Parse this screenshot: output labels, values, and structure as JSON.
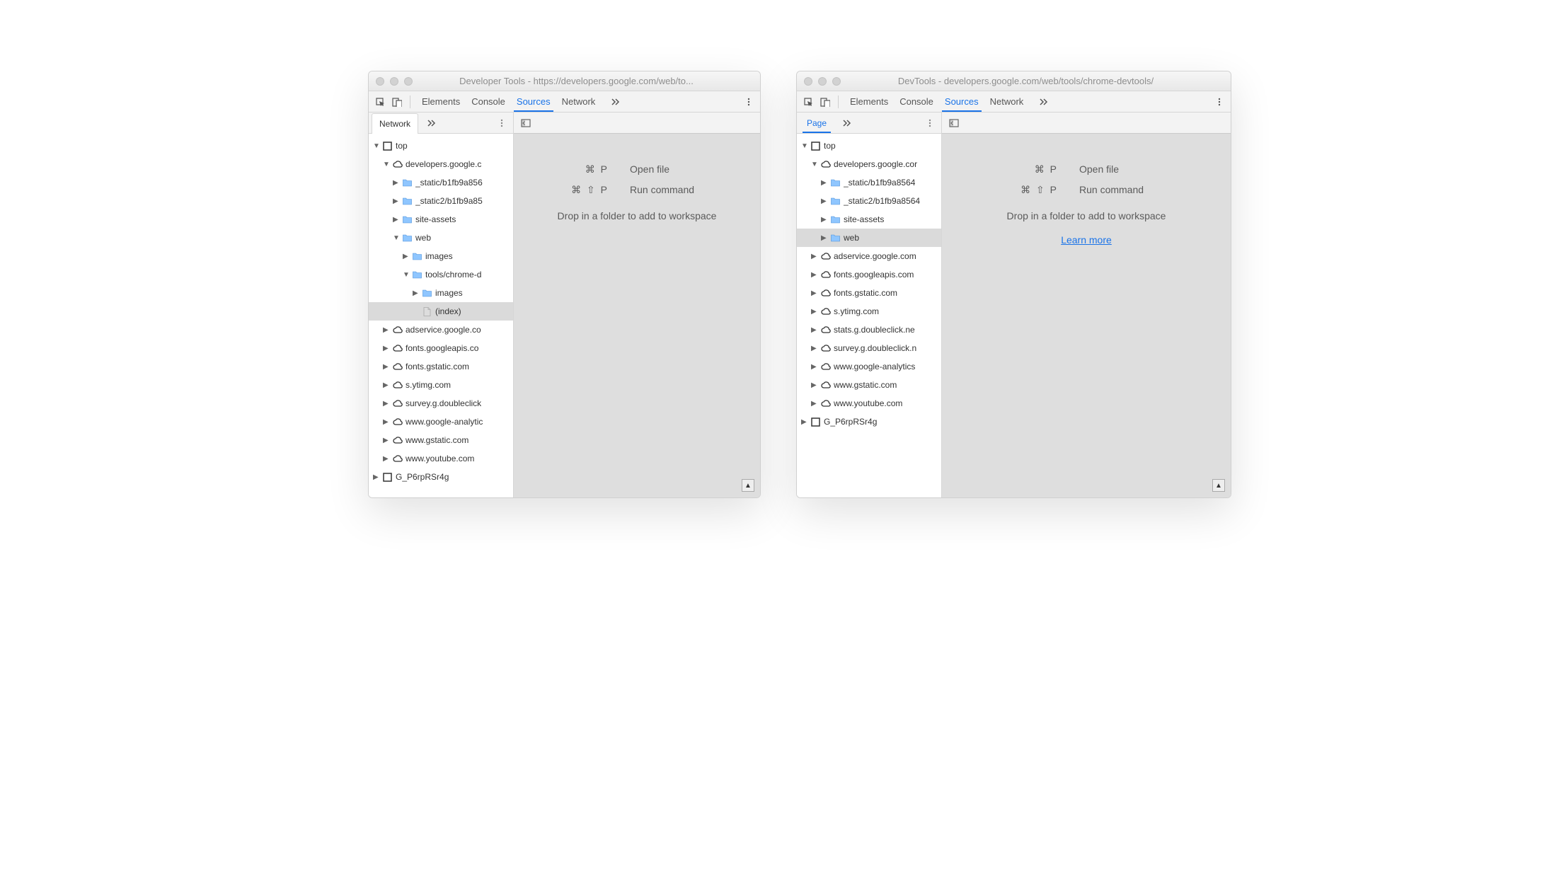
{
  "windows": [
    {
      "id": "left",
      "title": "Developer Tools - https://developers.google.com/web/to...",
      "tabs": [
        "Elements",
        "Console",
        "Sources",
        "Network"
      ],
      "activeTab": "Sources",
      "sidebarTab": "Network",
      "sidebarTabStyle": "classic",
      "tree": [
        {
          "indent": 0,
          "arrow": "down",
          "icon": "frame",
          "label": "top"
        },
        {
          "indent": 1,
          "arrow": "down",
          "icon": "cloud",
          "label": "developers.google.c"
        },
        {
          "indent": 2,
          "arrow": "right",
          "icon": "folder",
          "label": "_static/b1fb9a856"
        },
        {
          "indent": 2,
          "arrow": "right",
          "icon": "folder",
          "label": "_static2/b1fb9a85"
        },
        {
          "indent": 2,
          "arrow": "right",
          "icon": "folder",
          "label": "site-assets"
        },
        {
          "indent": 2,
          "arrow": "down",
          "icon": "folder",
          "label": "web"
        },
        {
          "indent": 3,
          "arrow": "right",
          "icon": "folder",
          "label": "images"
        },
        {
          "indent": 3,
          "arrow": "down",
          "icon": "folder",
          "label": "tools/chrome-d"
        },
        {
          "indent": 4,
          "arrow": "right",
          "icon": "folder",
          "label": "images"
        },
        {
          "indent": 4,
          "arrow": "blank",
          "icon": "file",
          "label": "(index)",
          "selected": true
        },
        {
          "indent": 1,
          "arrow": "right",
          "icon": "cloud",
          "label": "adservice.google.co"
        },
        {
          "indent": 1,
          "arrow": "right",
          "icon": "cloud",
          "label": "fonts.googleapis.co"
        },
        {
          "indent": 1,
          "arrow": "right",
          "icon": "cloud",
          "label": "fonts.gstatic.com"
        },
        {
          "indent": 1,
          "arrow": "right",
          "icon": "cloud",
          "label": "s.ytimg.com"
        },
        {
          "indent": 1,
          "arrow": "right",
          "icon": "cloud",
          "label": "survey.g.doubleclick"
        },
        {
          "indent": 1,
          "arrow": "right",
          "icon": "cloud",
          "label": "www.google-analytic"
        },
        {
          "indent": 1,
          "arrow": "right",
          "icon": "cloud",
          "label": "www.gstatic.com"
        },
        {
          "indent": 1,
          "arrow": "right",
          "icon": "cloud",
          "label": "www.youtube.com"
        },
        {
          "indent": 0,
          "arrow": "right",
          "icon": "frame",
          "label": "G_P6rpRSr4g"
        }
      ],
      "placeholder": {
        "openFileKey": "⌘ P",
        "openFileLabel": "Open file",
        "runCmdKey": "⌘ ⇧ P",
        "runCmdLabel": "Run command",
        "dropText": "Drop in a folder to add to workspace",
        "learnMore": null
      }
    },
    {
      "id": "right",
      "title": "DevTools - developers.google.com/web/tools/chrome-devtools/",
      "tabs": [
        "Elements",
        "Console",
        "Sources",
        "Network"
      ],
      "activeTab": "Sources",
      "sidebarTab": "Page",
      "sidebarTabStyle": "underline",
      "tree": [
        {
          "indent": 0,
          "arrow": "down",
          "icon": "frame",
          "label": "top"
        },
        {
          "indent": 1,
          "arrow": "down",
          "icon": "cloud",
          "label": "developers.google.cor"
        },
        {
          "indent": 2,
          "arrow": "right",
          "icon": "folder",
          "label": "_static/b1fb9a8564"
        },
        {
          "indent": 2,
          "arrow": "right",
          "icon": "folder",
          "label": "_static2/b1fb9a8564"
        },
        {
          "indent": 2,
          "arrow": "right",
          "icon": "folder",
          "label": "site-assets"
        },
        {
          "indent": 2,
          "arrow": "right",
          "icon": "folder",
          "label": "web",
          "selected": true
        },
        {
          "indent": 1,
          "arrow": "right",
          "icon": "cloud",
          "label": "adservice.google.com"
        },
        {
          "indent": 1,
          "arrow": "right",
          "icon": "cloud",
          "label": "fonts.googleapis.com"
        },
        {
          "indent": 1,
          "arrow": "right",
          "icon": "cloud",
          "label": "fonts.gstatic.com"
        },
        {
          "indent": 1,
          "arrow": "right",
          "icon": "cloud",
          "label": "s.ytimg.com"
        },
        {
          "indent": 1,
          "arrow": "right",
          "icon": "cloud",
          "label": "stats.g.doubleclick.ne"
        },
        {
          "indent": 1,
          "arrow": "right",
          "icon": "cloud",
          "label": "survey.g.doubleclick.n"
        },
        {
          "indent": 1,
          "arrow": "right",
          "icon": "cloud",
          "label": "www.google-analytics"
        },
        {
          "indent": 1,
          "arrow": "right",
          "icon": "cloud",
          "label": "www.gstatic.com"
        },
        {
          "indent": 1,
          "arrow": "right",
          "icon": "cloud",
          "label": "www.youtube.com"
        },
        {
          "indent": 0,
          "arrow": "right",
          "icon": "frame",
          "label": "G_P6rpRSr4g"
        }
      ],
      "placeholder": {
        "openFileKey": "⌘ P",
        "openFileLabel": "Open file",
        "runCmdKey": "⌘ ⇧ P",
        "runCmdLabel": "Run command",
        "dropText": "Drop in a folder to add to workspace",
        "learnMore": "Learn more"
      }
    }
  ]
}
